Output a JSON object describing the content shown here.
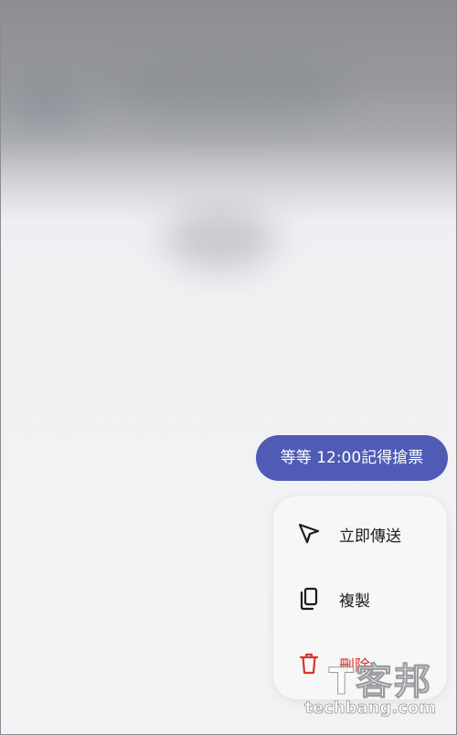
{
  "message": {
    "text": "等等 12:00記得搶票",
    "bubble_color": "#4f5bb4"
  },
  "context_menu": {
    "items": [
      {
        "label": "立即傳送",
        "icon": "send-icon"
      },
      {
        "label": "複製",
        "icon": "copy-icon"
      },
      {
        "label": "刪除",
        "icon": "trash-icon",
        "color": "#d8362f"
      }
    ]
  },
  "watermark": {
    "brand": "T客邦",
    "domain": "techbang.com"
  }
}
